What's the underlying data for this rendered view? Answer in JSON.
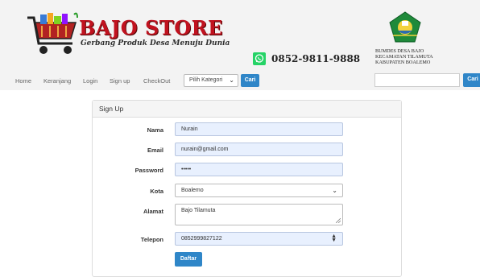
{
  "header": {
    "brand_name": "BAJO STORE",
    "tagline": "Gerbang Produk Desa Menuju Dunia",
    "phone": "0852-9811-9888",
    "org_lines": [
      "BUMDES DESA BAJO",
      "KECAMATAN TILAMUTA",
      "KABUPATEN BOALEMO"
    ],
    "accent_color": "#c1121f"
  },
  "nav": {
    "links": [
      "Home",
      "Keranjang",
      "Login",
      "Sign up",
      "CheckOut"
    ],
    "category_placeholder": "Pilih Kategori",
    "search_button": "Cari",
    "search_button_2": "Cari"
  },
  "form": {
    "title": "Sign Up",
    "fields": [
      {
        "label": "Nama",
        "value": "Nurain",
        "type": "text"
      },
      {
        "label": "Email",
        "value": "nurain@gmail.com",
        "type": "email"
      },
      {
        "label": "Password",
        "value": "•••••",
        "type": "password"
      },
      {
        "label": "Kota",
        "value": "Boalemo",
        "type": "select"
      },
      {
        "label": "Alamat",
        "value": "Bajo Tilamuta",
        "type": "textarea"
      },
      {
        "label": "Telepon",
        "value": "08529998271​22",
        "type": "number"
      }
    ],
    "submit_label": "Daftar"
  },
  "icons": {
    "cart": "shopping-cart-icon",
    "whatsapp": "whatsapp-icon",
    "emblem": "regency-emblem-icon"
  }
}
